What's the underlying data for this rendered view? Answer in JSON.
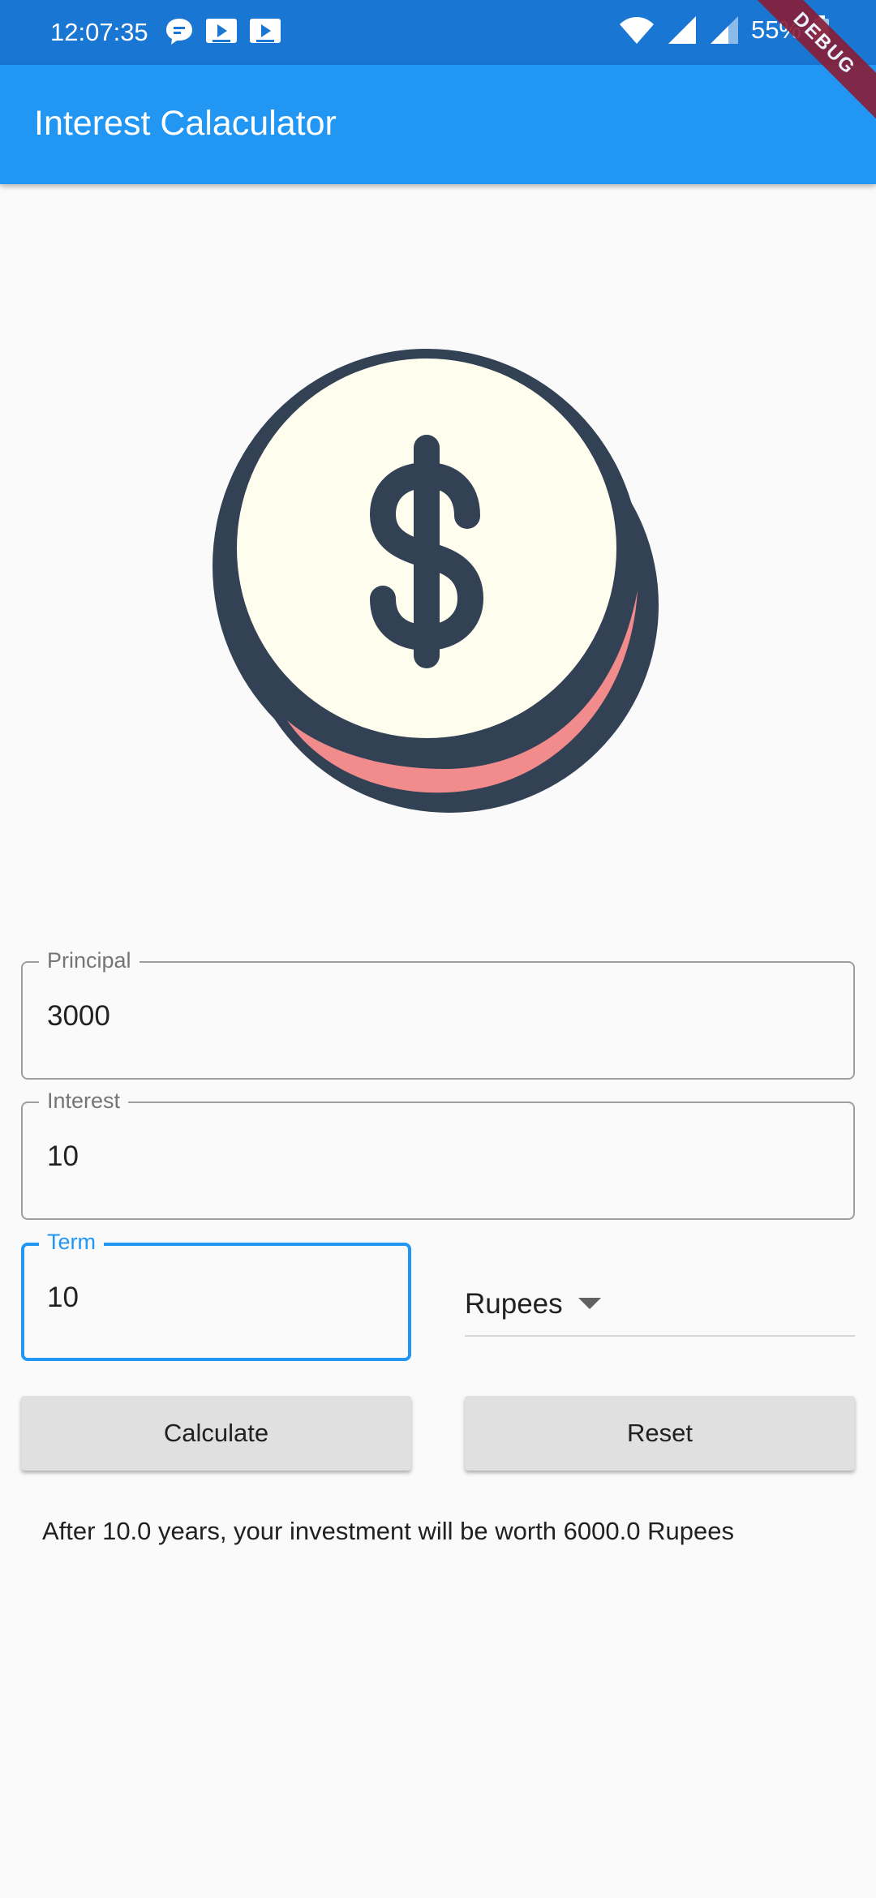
{
  "status_bar": {
    "time": "12:07:35",
    "battery": "55%",
    "icons_left": [
      "chat-bubble-icon",
      "screencast-icon",
      "screencast-icon"
    ],
    "icons_right": [
      "wifi-icon",
      "cell-signal-icon",
      "cell-signal-icon",
      "battery-icon"
    ]
  },
  "app_bar": {
    "title": "Interest Calaculator"
  },
  "debug_banner": "DEBUG",
  "hero": {
    "icon": "dollar-coin-icon",
    "colors": {
      "outline": "#334155",
      "face": "#fffdee",
      "edge": "#f28b8b"
    }
  },
  "form": {
    "principal": {
      "label": "Principal",
      "value": "3000"
    },
    "interest": {
      "label": "Interest",
      "value": "10"
    },
    "term": {
      "label": "Term",
      "value": "10"
    },
    "currency": {
      "selected": "Rupees"
    }
  },
  "buttons": {
    "calculate": "Calculate",
    "reset": "Reset"
  },
  "result": "After 10.0 years, your investment will be worth 6000.0 Rupees",
  "colors": {
    "primary": "#2196f3",
    "primary_dark": "#1976d2",
    "background": "#fafafa"
  }
}
